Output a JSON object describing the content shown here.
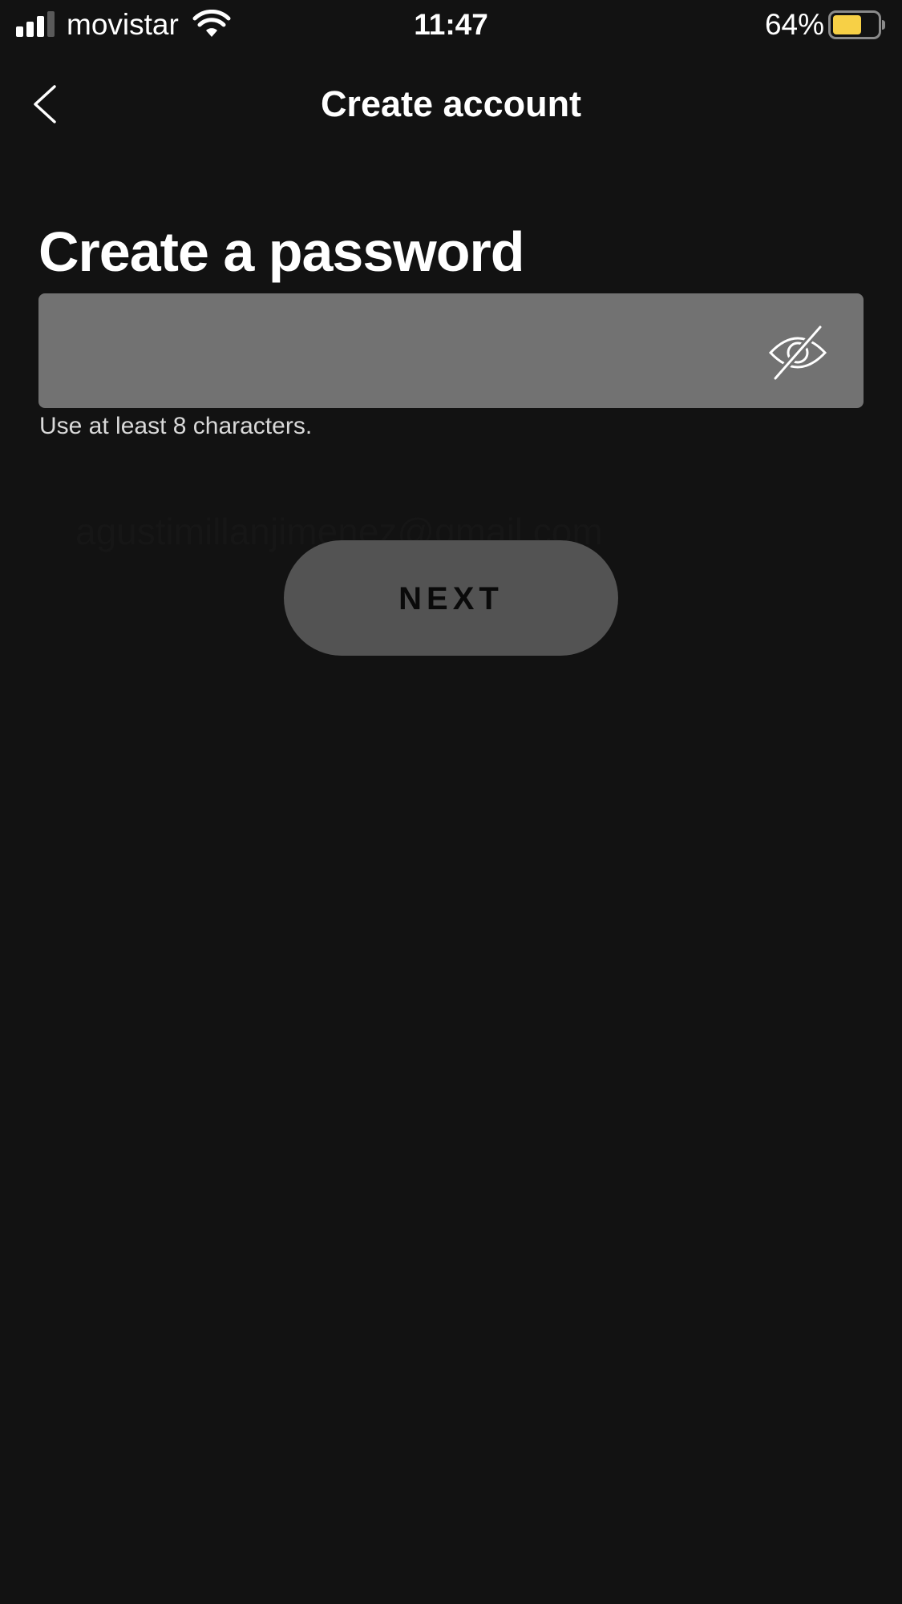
{
  "status_bar": {
    "carrier": "movistar",
    "time": "11:47",
    "battery_percent": "64%",
    "battery_level": 0.64,
    "battery_color": "#f7d046",
    "signal_bars_active": 3,
    "signal_bars_total": 4,
    "icons": [
      "signal-icon",
      "wifi-icon",
      "battery-icon"
    ]
  },
  "header": {
    "title": "Create account",
    "back_icon": "chevron-left-icon"
  },
  "form": {
    "heading": "Create a password",
    "password_value": "",
    "visibility_icon": "eye-slash-icon",
    "hint": "Use at least 8 characters.",
    "autofill_ghost": "agustimillanjimenez@gmail.com"
  },
  "actions": {
    "next_label": "NEXT"
  },
  "colors": {
    "background": "#121212",
    "field_background": "#727272",
    "button_background": "#535353",
    "button_text": "#0a0a0a"
  }
}
